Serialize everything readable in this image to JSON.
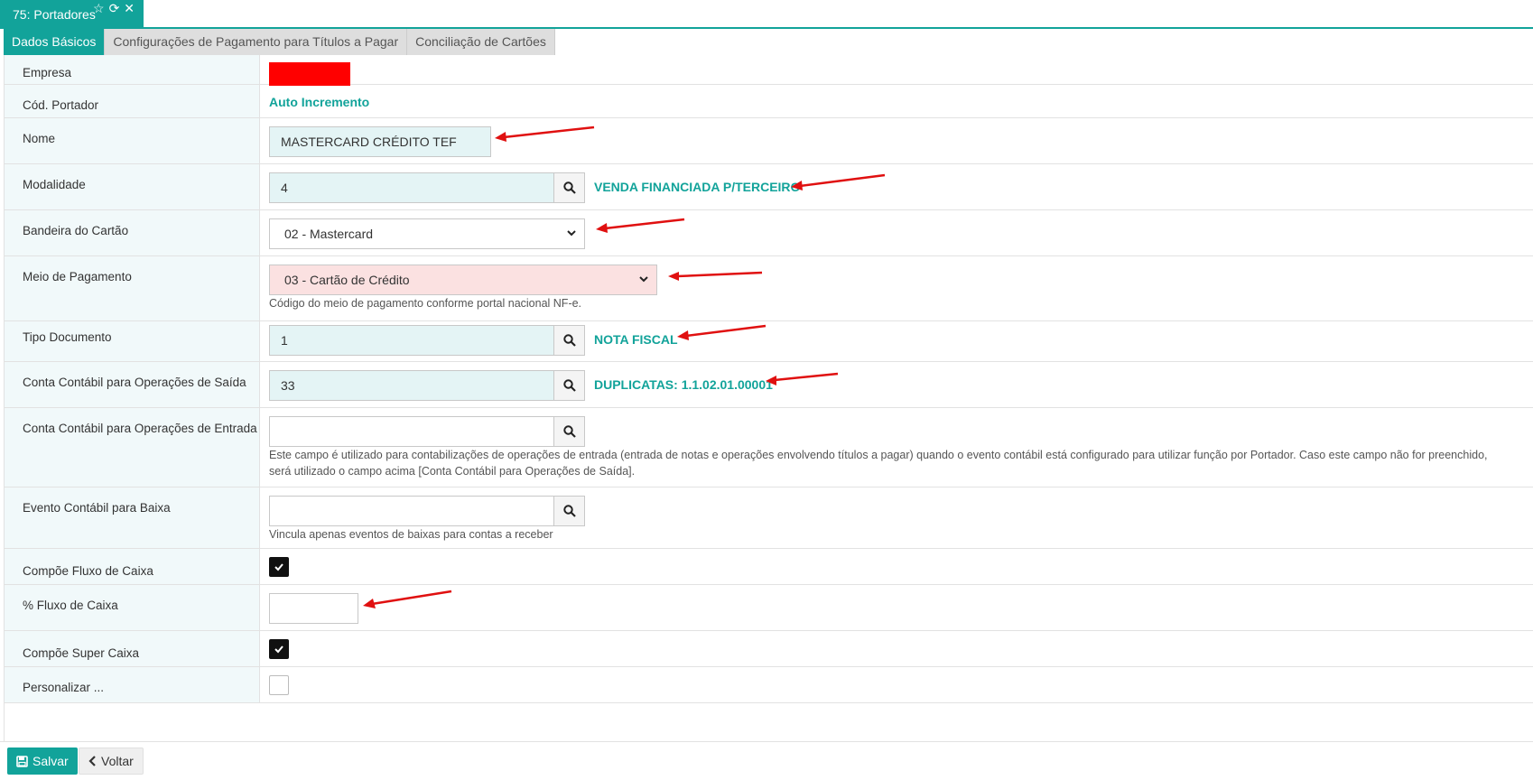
{
  "window": {
    "title": "75: Portadores",
    "icons": [
      "star-icon",
      "refresh-icon",
      "close-icon"
    ]
  },
  "subtabs": [
    {
      "label": "Dados Básicos",
      "active": true
    },
    {
      "label": "Configurações de Pagamento para Títulos a Pagar",
      "active": false
    },
    {
      "label": "Conciliação de Cartões",
      "active": false
    }
  ],
  "form": {
    "empresa": {
      "label": "Empresa"
    },
    "cod_portador": {
      "label": "Cód. Portador",
      "value": "Auto Incremento"
    },
    "nome": {
      "label": "Nome",
      "value": "MASTERCARD CRÉDITO  TEF"
    },
    "modalidade": {
      "label": "Modalidade",
      "value": "4",
      "description": "VENDA FINANCIADA P/TERCEIRO"
    },
    "bandeira": {
      "label": "Bandeira do Cartão",
      "value": "02 - Mastercard"
    },
    "meio_pagamento": {
      "label": "Meio de Pagamento",
      "value": "03 - Cartão de Crédito",
      "help": "Código do meio de pagamento conforme portal nacional NF-e."
    },
    "tipo_documento": {
      "label": "Tipo Documento",
      "value": "1",
      "description": "NOTA FISCAL"
    },
    "conta_saida": {
      "label": "Conta Contábil para Operações de Saída",
      "value": "33",
      "description": "DUPLICATAS: 1.1.02.01.00001"
    },
    "conta_entrada": {
      "label": "Conta Contábil para Operações de Entrada",
      "value": "",
      "help": "Este campo é utilizado para contabilizações de operações de entrada (entrada de notas e operações envolvendo títulos a pagar) quando o evento contábil está configurado para utilizar função por Portador. Caso este campo não for preenchido, será utilizado o campo acima [Conta Contábil para Operações de Saída]."
    },
    "evento_baixa": {
      "label": "Evento Contábil para Baixa",
      "value": "",
      "help": "Vincula apenas eventos de baixas para contas a receber"
    },
    "compoe_fluxo": {
      "label": "Compõe Fluxo de Caixa",
      "checked": true
    },
    "pct_fluxo": {
      "label": "% Fluxo de Caixa",
      "value": ""
    },
    "compoe_super": {
      "label": "Compõe Super Caixa",
      "checked": true
    },
    "next_row": {
      "label": "Personalizar ...",
      "checked": false
    }
  },
  "footer": {
    "save_label": "Salvar",
    "back_label": "Voltar"
  },
  "colors": {
    "accent": "#12a39a",
    "annotation_arrow": "#e01010",
    "redacted": "#ff0000"
  }
}
